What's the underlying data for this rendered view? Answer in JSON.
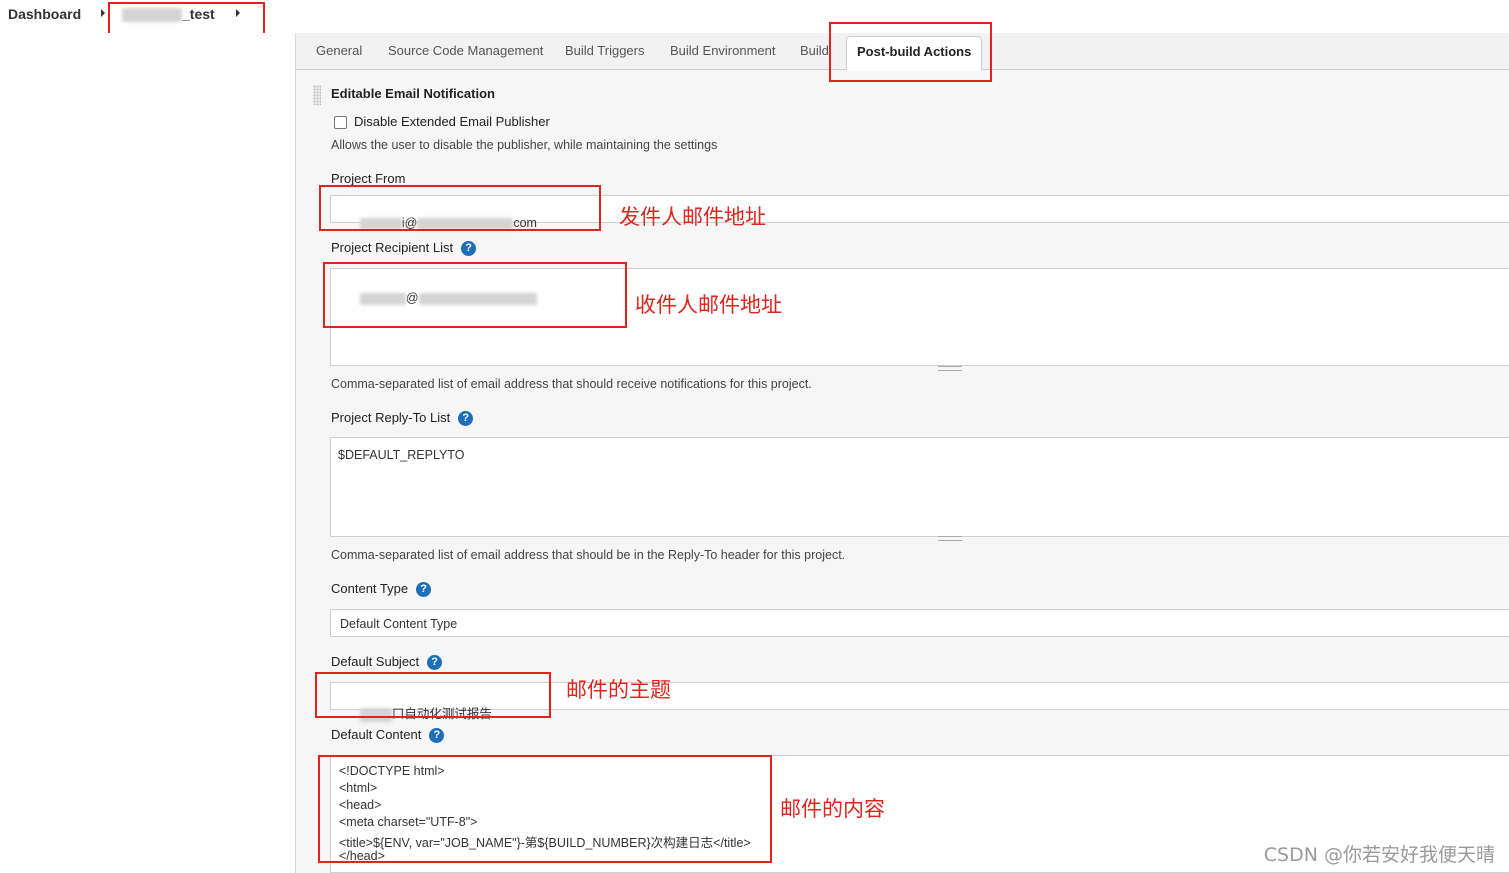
{
  "breadcrumb": {
    "dashboard": "Dashboard",
    "project": "_test"
  },
  "tabs": [
    "General",
    "Source Code Management",
    "Build Triggers",
    "Build Environment",
    "Build",
    "Post-build Actions"
  ],
  "active_tab": "Post-build Actions",
  "section": {
    "title": "Editable Email Notification",
    "disable_label": "Disable Extended Email Publisher",
    "disable_checked": false,
    "disable_hint": "Allows the user to disable the publisher, while maintaining the settings"
  },
  "project_from": {
    "label": "Project From",
    "value_mid": "i@",
    "value_end": "com"
  },
  "recipient_list": {
    "label": "Project Recipient List",
    "value_mid": "@",
    "hint": "Comma-separated list of email address that should receive notifications for this project."
  },
  "reply_to": {
    "label": "Project Reply-To List",
    "value": "$DEFAULT_REPLYTO",
    "hint": "Comma-separated list of email address that should be in the Reply-To header for this project."
  },
  "content_type": {
    "label": "Content Type",
    "value": "Default Content Type"
  },
  "default_subject": {
    "label": "Default Subject",
    "value": "口自动化测试报告"
  },
  "default_content": {
    "label": "Default Content",
    "lines": [
      "<!DOCTYPE html>",
      "<html>",
      "<head>",
      "<meta charset=\"UTF-8\">",
      "<title>${ENV, var=\"JOB_NAME\"}-第${BUILD_NUMBER}次构建日志</title>",
      "</head>"
    ]
  },
  "annotations": {
    "sender": "发件人邮件地址",
    "recipient": "收件人邮件地址",
    "subject": "邮件的主题",
    "content": "邮件的内容"
  },
  "help_glyph": "?",
  "watermark": "CSDN @你若安好我便天晴",
  "colors": {
    "annotation_red": "#e0241d",
    "help_blue": "#1d6fb8"
  }
}
